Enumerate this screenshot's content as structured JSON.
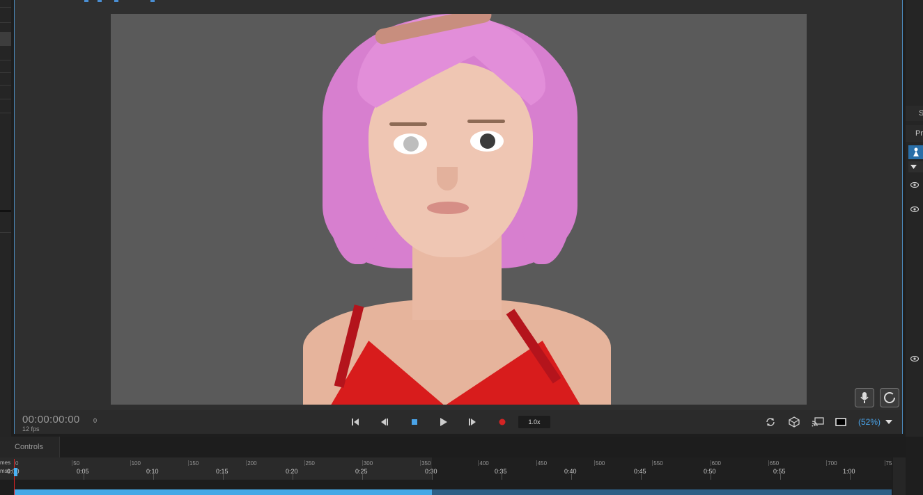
{
  "timecode": "00:00:00:00",
  "fps": "12 fps",
  "frame": "0",
  "speed": "1.0x",
  "zoom": "(52%)",
  "right_panel": {
    "header1": "S",
    "header2": "Pr"
  },
  "bottom": {
    "controls_tab": "Controls",
    "ruler_label_frames": "mes",
    "ruler_label_time": "mss"
  },
  "ruler": {
    "frames": [
      "0",
      "50",
      "100",
      "150",
      "200",
      "250",
      "300",
      "350",
      "400",
      "450",
      "500",
      "550",
      "600",
      "650",
      "700",
      "75"
    ],
    "times": [
      "0:00",
      "0:05",
      "0:10",
      "0:15",
      "0:20",
      "0:25",
      "0:30",
      "0:35",
      "0:40",
      "0:45",
      "0:50",
      "0:55",
      "1:00"
    ]
  },
  "colors": {
    "accent": "#4aa3e8",
    "record": "#d42424",
    "track": "#45a8e6",
    "hair": "#d77fcf",
    "top": "#d81c1c"
  },
  "icons": [
    "skip-to-start-icon",
    "step-back-icon",
    "stop-icon",
    "play-icon",
    "step-forward-icon",
    "record-icon",
    "loop-icon",
    "camera-cube-icon",
    "cast-icon",
    "aspect-frame-icon",
    "dropdown-arrow-icon",
    "microphone-icon",
    "refresh-circle-icon",
    "eye-icon"
  ]
}
